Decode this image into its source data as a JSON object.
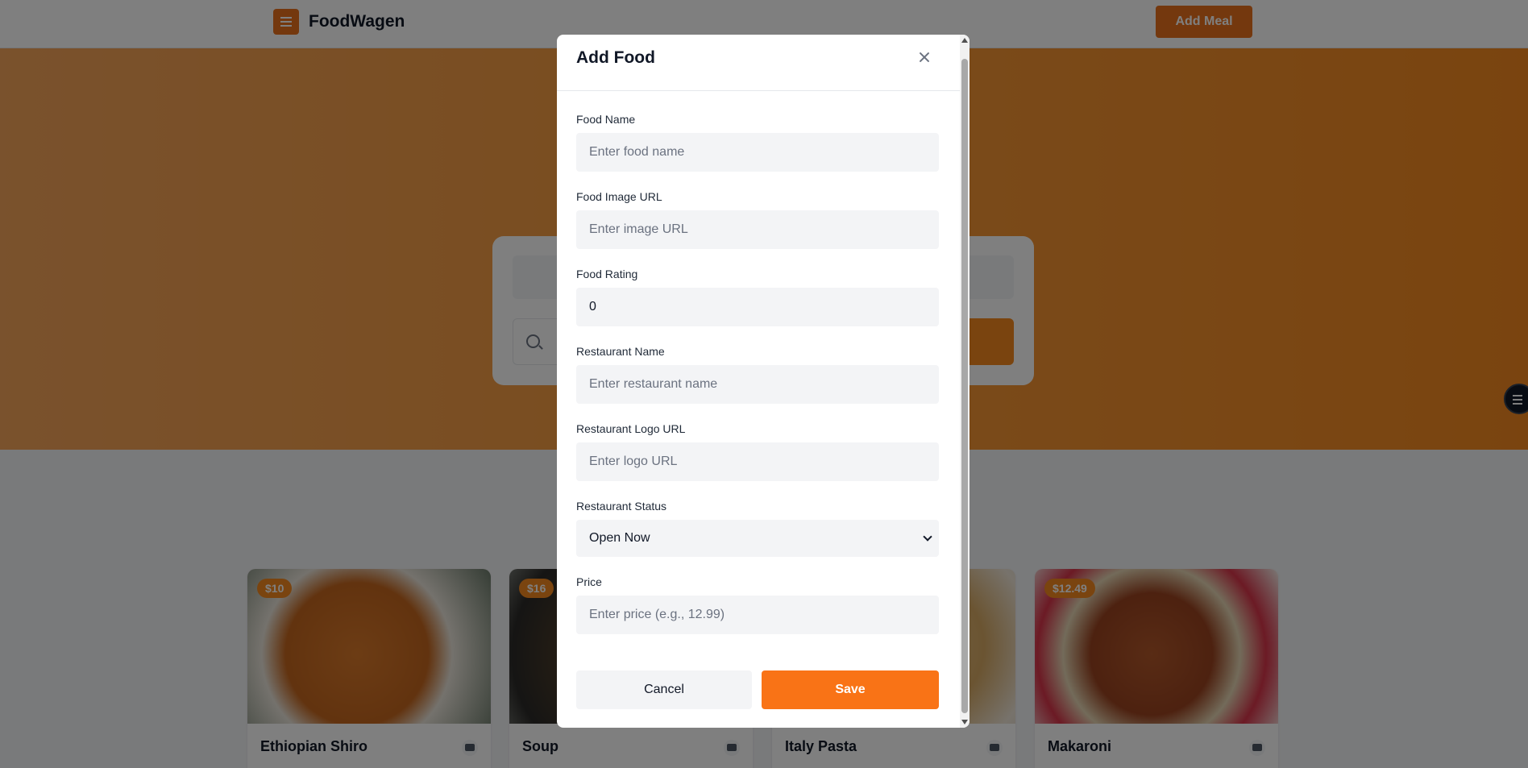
{
  "navbar": {
    "brand": "FoodWagen",
    "add_meal": "Add Meal"
  },
  "hero": {
    "title": "",
    "subtitle": "",
    "search_placeholder": "",
    "search_button": ""
  },
  "cards": [
    {
      "price": "$10",
      "name": "Ethiopian Shiro",
      "restaurant": ""
    },
    {
      "price": "$16",
      "name": "Soup",
      "restaurant": ""
    },
    {
      "price": "",
      "name": "Italy Pasta",
      "restaurant": ""
    },
    {
      "price": "$12.49",
      "name": "Makaroni",
      "restaurant": ""
    }
  ],
  "modal": {
    "title": "Add Food",
    "fields": {
      "food_name": {
        "label": "Food Name",
        "placeholder": "Enter food name"
      },
      "image_url": {
        "label": "Food Image URL",
        "placeholder": "Enter image URL"
      },
      "rating": {
        "label": "Food Rating",
        "value": "0"
      },
      "restaurant_name": {
        "label": "Restaurant Name",
        "placeholder": "Enter restaurant name"
      },
      "logo_url": {
        "label": "Restaurant Logo URL",
        "placeholder": "Enter logo URL"
      },
      "status": {
        "label": "Restaurant Status",
        "selected": "Open Now"
      },
      "price": {
        "label": "Price",
        "placeholder": "Enter price (e.g., 12.99)"
      }
    },
    "cancel": "Cancel",
    "save": "Save"
  },
  "colors": {
    "brand": "#e8711c",
    "save": "#f97316",
    "overlay": "rgba(0,0,0,0.5)"
  }
}
